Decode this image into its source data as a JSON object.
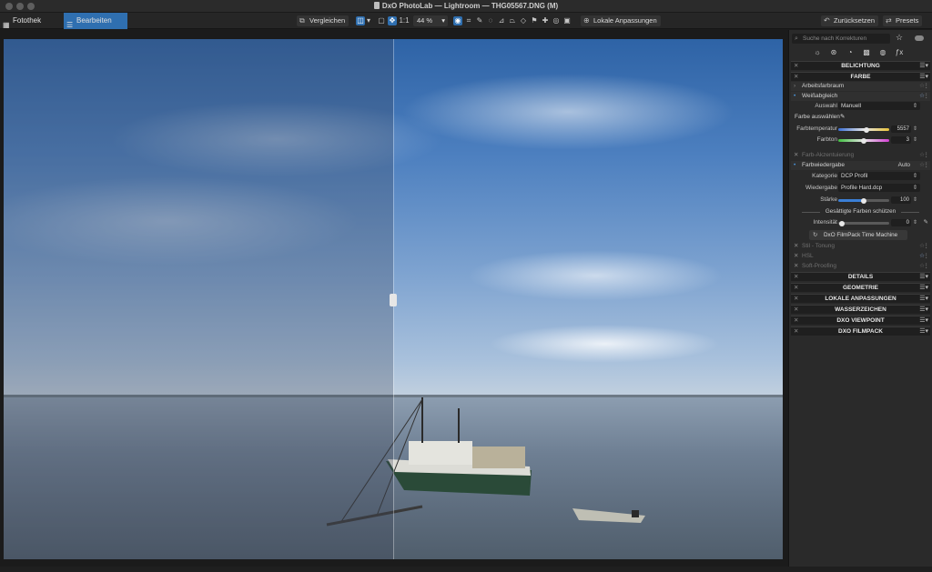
{
  "window": {
    "title": "DxO PhotoLab — Lightroom — THG05567.DNG (M)"
  },
  "toolbar": {
    "tab_library": "Fotothek",
    "tab_edit": "Bearbeiten",
    "compare_label": "Vergleichen",
    "one_to_one": "1:1",
    "zoom_value": "44 %",
    "local_adjust_label": "Lokale Anpassungen",
    "reset_label": "Zurücksetzen",
    "presets_label": "Presets"
  },
  "panel": {
    "search_placeholder": "Suche nach Korrekturen",
    "sections_top": {
      "belichtung": "BELICHTUNG",
      "farbe": "FARBE"
    },
    "farbe": {
      "arbeitsfarbraum": "Arbeitsfarbraum",
      "weissabgleich": "Weißabgleich",
      "auswahl_label": "Auswahl",
      "auswahl_value": "Manuell",
      "farbe_auswaehlen": "Farbe auswählen",
      "farbtemperatur_label": "Farbtemperatur",
      "farbtemperatur_value": "5557",
      "farbton_label": "Farbton",
      "farbton_value": "3",
      "farb_akzentuierung": "Farb-Akzentuierung",
      "farbwiedergabe": "Farbwiedergabe",
      "farbwiedergabe_mode": "Auto",
      "kategorie_label": "Kategorie",
      "kategorie_value": "DCP Profil",
      "wiedergabe_label": "Wiedergabe",
      "wiedergabe_value": "Profile Hard.dcp",
      "staerke_label": "Stärke",
      "staerke_value": "100",
      "protect_label": "Gesättigte Farben schützen",
      "intensitaet_label": "Intensität",
      "intensitaet_value": "0",
      "filmpack_button": "DxO FilmPack Time Machine",
      "split_toning": "Stil - Tonung",
      "hsl": "HSL",
      "soft_proofing": "Soft-Proofing"
    },
    "sections_bottom": [
      "DETAILS",
      "GEOMETRIE",
      "LOKALE ANPASSUNGEN",
      "WASSERZEICHEN",
      "DXO VIEWPOINT",
      "DXO FILMPACK"
    ]
  },
  "colors": {
    "accent": "#2f6fb0",
    "panel_bg": "#2a2a2a",
    "header_bg": "#1f1f1f"
  },
  "sliders": {
    "farbtemperatur_fraction": 0.55,
    "farbton_fraction": 0.5,
    "staerke_fraction": 0.5,
    "intensitaet_fraction": 0.02
  }
}
